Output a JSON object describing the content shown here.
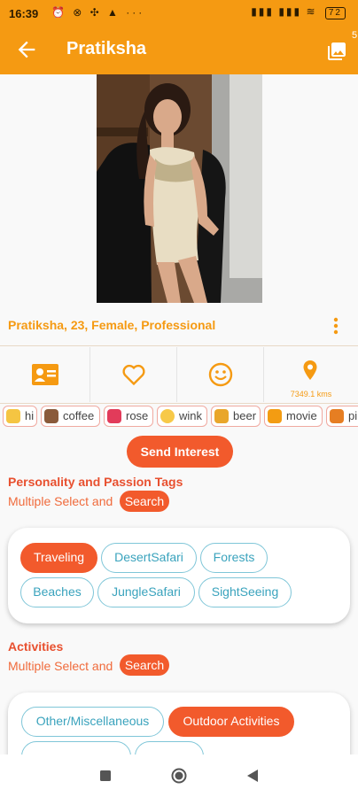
{
  "status_bar": {
    "time": "16:39",
    "left_icons": "⏰ ⊗ ✣ ▲ ···",
    "right_icons": "▮▮▮ ▮▮▮ ≋",
    "battery": "72"
  },
  "app_bar": {
    "title": "Pratiksha",
    "photo_count": "5"
  },
  "profile": {
    "name_line": "Pratiksha, 23, Female, Professional",
    "distance": "7349.1 kms"
  },
  "emoji_chips": [
    {
      "label": "hi",
      "icon": "waving-hand-icon",
      "color": "#f5c542"
    },
    {
      "label": "coffee",
      "icon": "coffee-icon",
      "color": "#8a5a3a"
    },
    {
      "label": "rose",
      "icon": "rose-icon",
      "color": "#e23b5a"
    },
    {
      "label": "wink",
      "icon": "wink-face-icon",
      "color": "#f7c948"
    },
    {
      "label": "beer",
      "icon": "beer-icon",
      "color": "#e9a62b"
    },
    {
      "label": "movie",
      "icon": "movie-icon",
      "color": "#f39c12"
    },
    {
      "label": "pi",
      "icon": "pizza-icon",
      "color": "#e67e22"
    }
  ],
  "send_interest_label": "Send Interest",
  "personality_section": {
    "title": "Personality and Passion Tags",
    "subtitle": "Multiple Select and",
    "search_label": "Search",
    "tags": [
      {
        "label": "Traveling",
        "selected": true
      },
      {
        "label": "DesertSafari",
        "selected": false
      },
      {
        "label": "Forests",
        "selected": false
      },
      {
        "label": "Beaches",
        "selected": false
      },
      {
        "label": "JungleSafari",
        "selected": false
      },
      {
        "label": "SightSeeing",
        "selected": false
      }
    ]
  },
  "activities_section": {
    "title": "Activities",
    "subtitle": "Multiple Select and",
    "search_label": "Search",
    "tags": [
      {
        "label": "Other/Miscellaneous",
        "selected": false
      },
      {
        "label": "Outdoor Activities",
        "selected": true
      }
    ]
  },
  "colors": {
    "brand": "#f59a12",
    "accent": "#f25a2c",
    "tag_border": "#7fc6d8",
    "tag_text": "#3aa3bd"
  }
}
